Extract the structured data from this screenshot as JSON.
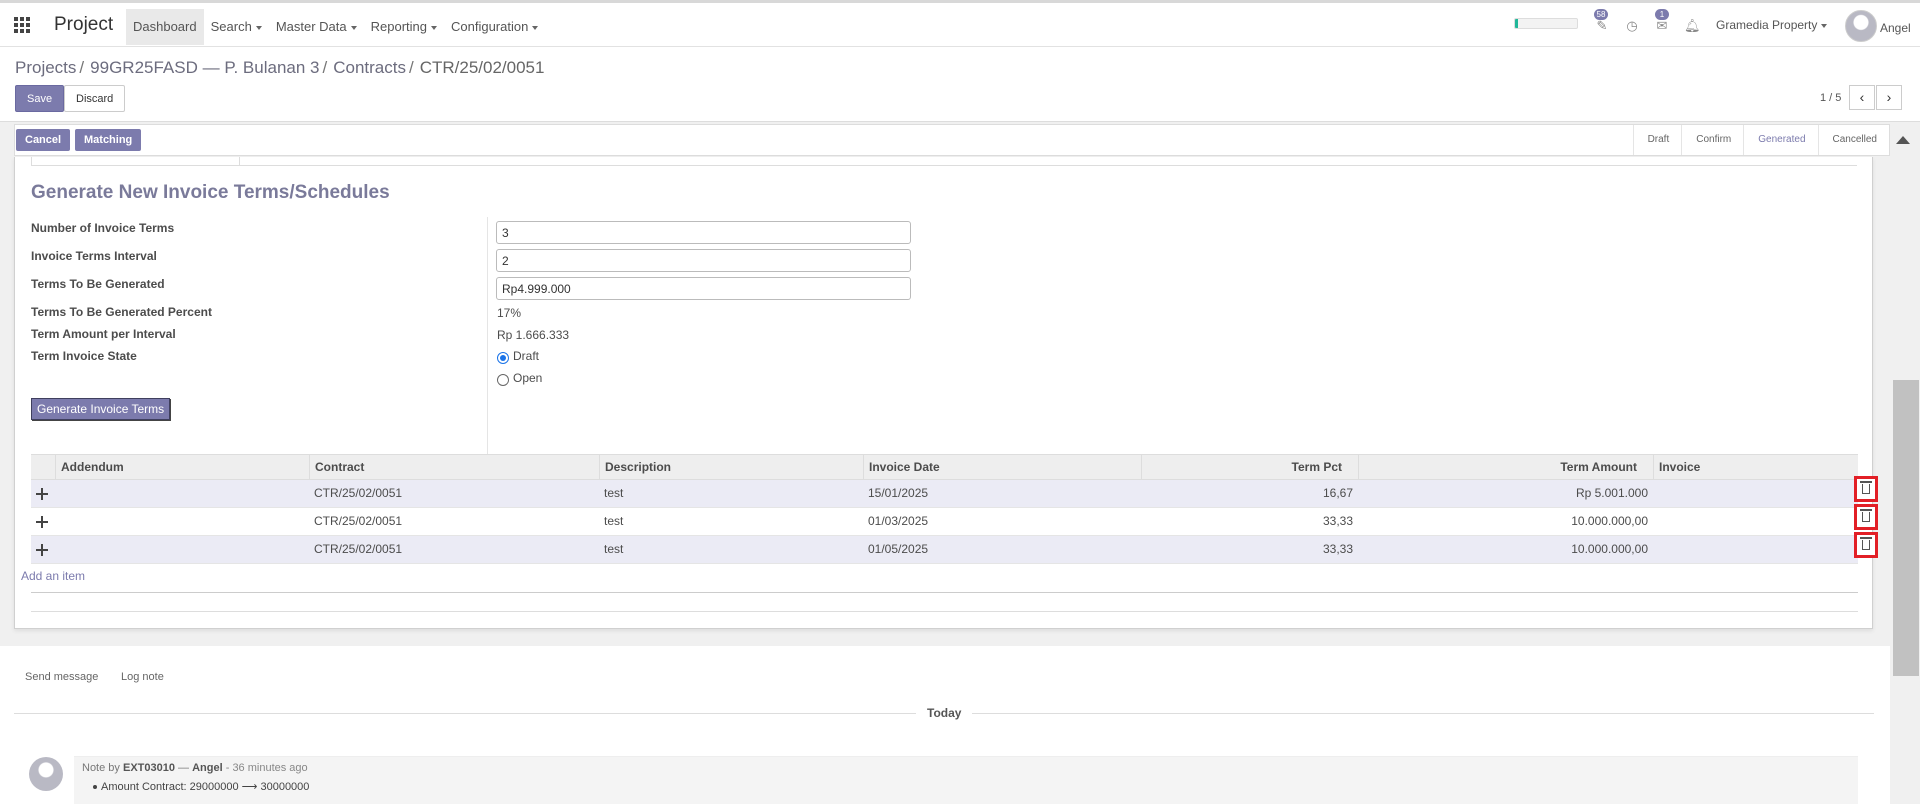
{
  "navbar": {
    "app_name": "Project",
    "menu": [
      {
        "label": "Dashboard"
      },
      {
        "label": "Search"
      },
      {
        "label": "Master Data"
      },
      {
        "label": "Reporting"
      },
      {
        "label": "Configuration"
      }
    ],
    "progress_fraction": 0.05,
    "activity_badge": "58",
    "messages_badge": "1",
    "company": "Gramedia Property",
    "user": "Angel"
  },
  "breadcrumb": {
    "items": [
      "Projects",
      "99GR25FASD — P. Bulanan 3",
      "Contracts"
    ],
    "current": "CTR/25/02/0051"
  },
  "buttons": {
    "save": "Save",
    "discard": "Discard"
  },
  "pager": {
    "value": "1 / 5"
  },
  "statusbar": {
    "cancel": "Cancel",
    "matching": "Matching",
    "stages": [
      "Draft",
      "Confirm",
      "Generated",
      "Cancelled"
    ],
    "current_stage": "Generated"
  },
  "form": {
    "section_title": "Generate New Invoice Terms/Schedules",
    "labels": {
      "num_terms": "Number of Invoice Terms",
      "interval": "Invoice Terms Interval",
      "to_generate": "Terms To Be Generated",
      "to_generate_pct": "Terms To Be Generated Percent",
      "amount_per_interval": "Term Amount per Interval",
      "invoice_state": "Term Invoice State"
    },
    "values": {
      "num_terms": "3",
      "interval": "2",
      "to_generate": "Rp4.999.000",
      "to_generate_pct": "17%",
      "amount_per_interval": "Rp 1.666.333"
    },
    "state_options": [
      "Draft",
      "Open"
    ],
    "state_selected": "Draft",
    "generate_button": "Generate Invoice Terms"
  },
  "table": {
    "headers": [
      "Addendum",
      "Contract",
      "Description",
      "Invoice Date",
      "Term Pct",
      "Term Amount",
      "Invoice"
    ],
    "rows": [
      {
        "addendum": "",
        "contract": "CTR/25/02/0051",
        "description": "test",
        "date": "15/01/2025",
        "pct": "16,67",
        "amount": "Rp 5.001.000",
        "invoice": ""
      },
      {
        "addendum": "",
        "contract": "CTR/25/02/0051",
        "description": "test",
        "date": "01/03/2025",
        "pct": "33,33",
        "amount": "10.000.000,00",
        "invoice": ""
      },
      {
        "addendum": "",
        "contract": "CTR/25/02/0051",
        "description": "test",
        "date": "01/05/2025",
        "pct": "33,33",
        "amount": "10.000.000,00",
        "invoice": ""
      }
    ],
    "add_item": "Add an item"
  },
  "chatter": {
    "send_message": "Send message",
    "log_note": "Log note",
    "separator": "Today",
    "message": {
      "prefix": "Note by",
      "author": "EXT03010",
      "dash": "—",
      "user": "Angel",
      "time": "- 36 minutes ago",
      "body": "Amount Contract: 29000000 ⟶ 30000000"
    }
  },
  "colors": {
    "primary": "#7c7bad",
    "highlight_border": "#e21f26"
  }
}
